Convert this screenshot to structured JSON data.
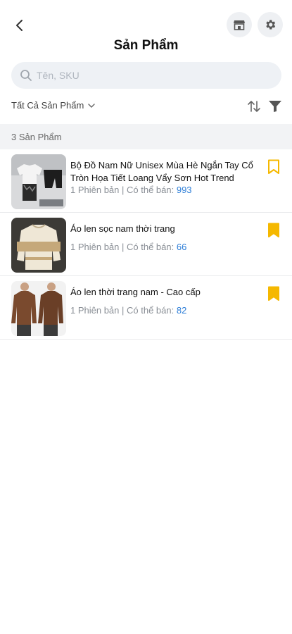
{
  "header": {
    "title": "Sản Phẩm",
    "back_icon": "chevron-left-icon",
    "store_icon": "store-icon",
    "settings_icon": "gear-icon"
  },
  "search": {
    "placeholder": "Tên, SKU",
    "value": ""
  },
  "filter": {
    "category_label": "Tất Cả Sản Phẩm",
    "sort_icon": "sort-icon",
    "filter_icon": "filter-icon"
  },
  "summary": {
    "count_label": "3 Sản Phẩm"
  },
  "products": [
    {
      "name": "Bộ Đồ Nam Nữ Unisex Mùa Hè Ngắn Tay Cổ Tròn Họa Tiết Loang Vẩy Sơn Hot Trend",
      "variants": "1 Phiên bản",
      "separator": " | ",
      "available_label": "Có thể bán: ",
      "available": "993",
      "bookmarked": false
    },
    {
      "name": "Áo len sọc nam thời trang",
      "variants": "1 Phiên bản",
      "separator": " | ",
      "available_label": "Có thể bán: ",
      "available": "66",
      "bookmarked": true
    },
    {
      "name": "Áo len thời trang nam - Cao cấp",
      "variants": "1 Phiên bản",
      "separator": " | ",
      "available_label": "Có thể bán: ",
      "available": "82",
      "bookmarked": true
    }
  ],
  "colors": {
    "accent": "#2f7fd8",
    "bookmark": "#f5b800",
    "title": "#111111",
    "muted": "#8a8f96"
  }
}
